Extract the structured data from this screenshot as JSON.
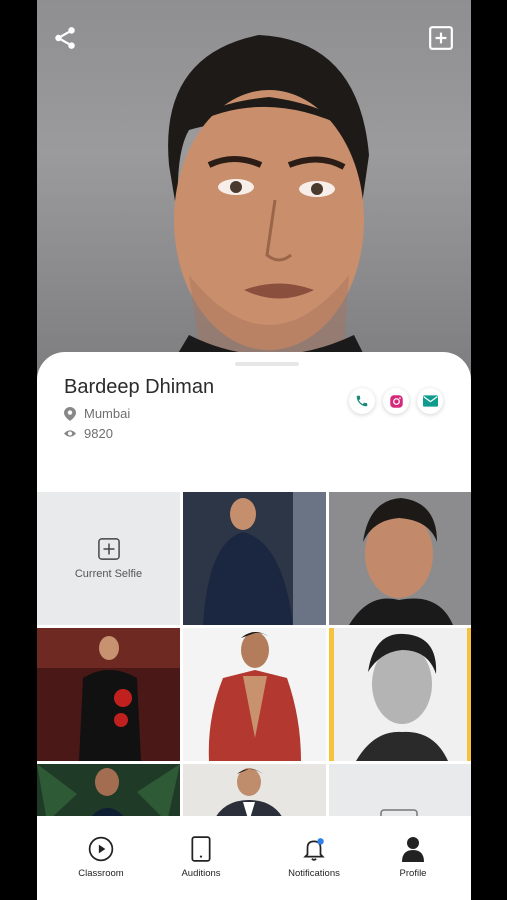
{
  "profile": {
    "name": "Bardeep Dhiman",
    "city": "Mumbai",
    "views": "9820"
  },
  "gallery": {
    "selfie_label": "Current Selfie",
    "photos": [
      "photo-1",
      "photo-2",
      "photo-3",
      "photo-4",
      "photo-5",
      "photo-6",
      "photo-7",
      "photo-8"
    ]
  },
  "nav": {
    "items": [
      {
        "label": "Classroom",
        "icon": "play-circle-icon"
      },
      {
        "label": "Auditions",
        "icon": "tablet-icon"
      },
      {
        "label": "Notifications",
        "icon": "bell-icon"
      },
      {
        "label": "Profile",
        "icon": "person-icon"
      }
    ]
  },
  "colors": {
    "phone_accent": "#1b8a7a",
    "mail_accent": "#0f9b8e",
    "instagram_pink": "#d6287a",
    "notification_dot": "#2f80ed",
    "selected_frame": "#f6c23e"
  }
}
